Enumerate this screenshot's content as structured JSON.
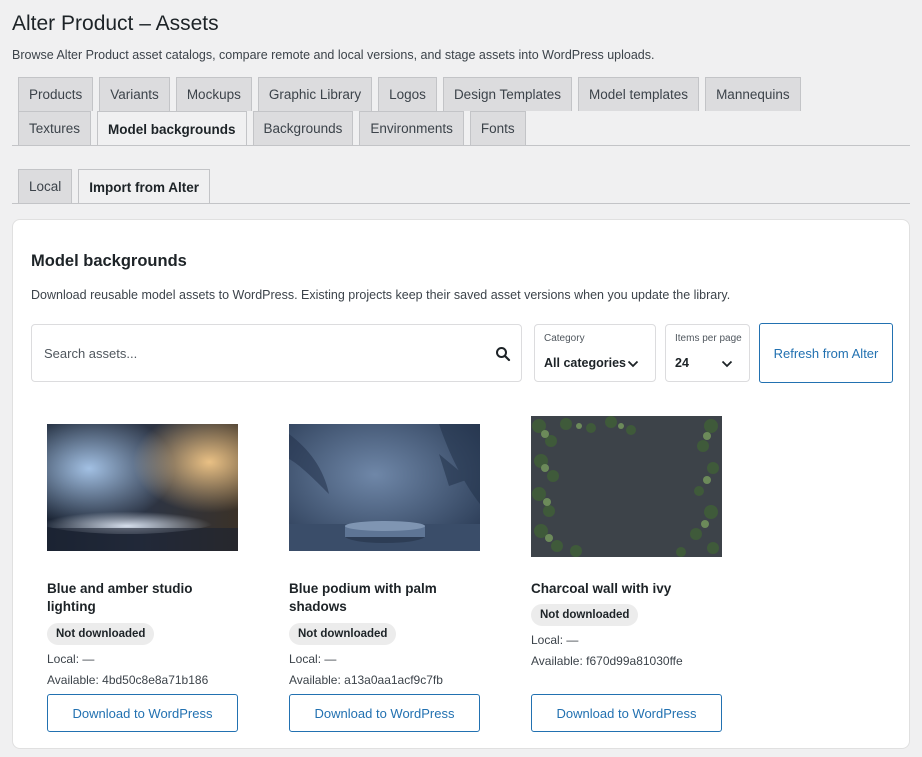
{
  "header": {
    "title": "Alter Product – Assets",
    "description": "Browse Alter Product asset catalogs, compare remote and local versions, and stage assets into WordPress uploads."
  },
  "tabs": {
    "row1": [
      {
        "label": "Products",
        "active": false
      },
      {
        "label": "Variants",
        "active": false
      },
      {
        "label": "Mockups",
        "active": false
      },
      {
        "label": "Graphic Library",
        "active": false
      },
      {
        "label": "Logos",
        "active": false
      },
      {
        "label": "Design Templates",
        "active": false
      },
      {
        "label": "Model templates",
        "active": false
      },
      {
        "label": "Mannequins",
        "active": false
      }
    ],
    "row2": [
      {
        "label": "Textures",
        "active": false
      },
      {
        "label": "Model backgrounds",
        "active": true
      },
      {
        "label": "Backgrounds",
        "active": false
      },
      {
        "label": "Environments",
        "active": false
      },
      {
        "label": "Fonts",
        "active": false
      }
    ]
  },
  "subtabs": [
    {
      "label": "Local",
      "active": false
    },
    {
      "label": "Import from Alter",
      "active": true
    }
  ],
  "panel": {
    "title": "Model backgrounds",
    "description": "Download reusable model assets to WordPress. Existing projects keep their saved asset versions when you update the library."
  },
  "search": {
    "placeholder": "Search assets...",
    "icon": "search-icon"
  },
  "category": {
    "label": "Category",
    "value": "All categories"
  },
  "per_page": {
    "label": "Items per page",
    "value": "24"
  },
  "refresh_label": "Refresh from Alter",
  "assets": [
    {
      "title": "Blue and amber studio lighting",
      "status": "Not downloaded",
      "local": "Local: —",
      "available": "Available: 4bd50c8e8a71b186",
      "button": "Download to WordPress"
    },
    {
      "title": "Blue podium with palm shadows",
      "status": "Not downloaded",
      "local": "Local: —",
      "available": "Available: a13a0aa1acf9c7fb",
      "button": "Download to WordPress"
    },
    {
      "title": "Charcoal wall with ivy",
      "status": "Not downloaded",
      "local": "Local: —",
      "available": "Available: f670d99a81030ffe",
      "button": "Download to WordPress"
    }
  ],
  "colors": {
    "accent": "#2271b1",
    "page_bg": "#f0f0f1",
    "tab_bg": "#dcdcde",
    "badge_bg": "#ececec"
  }
}
